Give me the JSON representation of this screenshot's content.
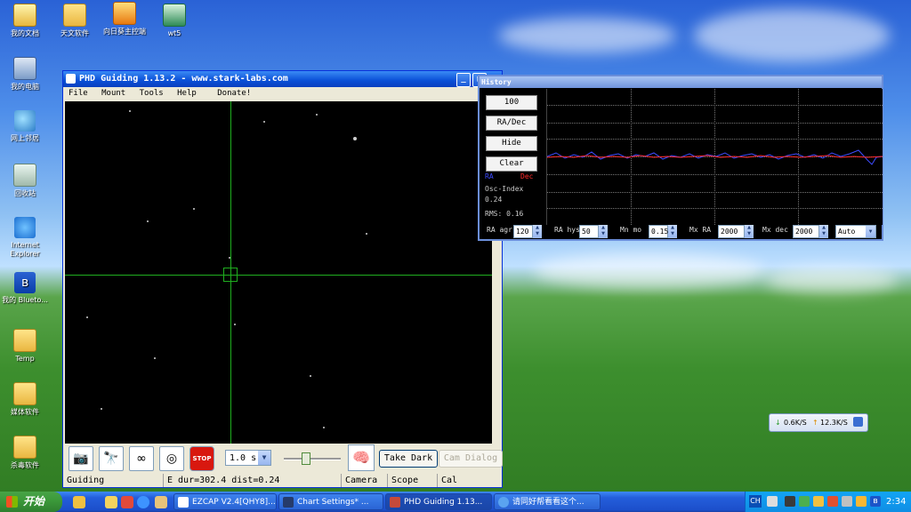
{
  "desktop": {
    "icons": [
      {
        "label": "我的文档"
      },
      {
        "label": "天文软件"
      },
      {
        "label": "向日葵主控端"
      },
      {
        "label": "wt5"
      },
      {
        "label": "我的电脑"
      },
      {
        "label": "网上邻居"
      },
      {
        "label": "回收站"
      },
      {
        "label": "Internet Explorer"
      },
      {
        "label": "我的 Blueto..."
      },
      {
        "label": "Temp"
      },
      {
        "label": "媒体软件"
      },
      {
        "label": "杀毒软件"
      }
    ]
  },
  "phd": {
    "title": "PHD Guiding 1.13.2  -  www.stark-labs.com",
    "menu": [
      "File",
      "Mount",
      "Tools",
      "Help",
      "Donate!"
    ],
    "exposure": "1.0 s",
    "take_dark": "Take Dark",
    "cam_dialog": "Cam Dialog",
    "status": {
      "mode": "Guiding",
      "info": "E dur=302.4 dist=0.24",
      "camera": "Camera",
      "scope": "Scope",
      "cal": "Cal"
    },
    "titlebar_buttons": {
      "minimize": "_",
      "maximize": "□"
    }
  },
  "history": {
    "title": "History",
    "buttons": {
      "length": "100",
      "mode": "RA/Dec",
      "hide": "Hide",
      "clear": "Clear"
    },
    "legend": {
      "ra": "RA",
      "dec": "Dec",
      "ra_color": "#3d4bff",
      "dec_color": "#ff2a2a"
    },
    "osc_label": "Osc-Index",
    "osc_value": "0.24",
    "rms": "RMS: 0.16",
    "controls": {
      "ra_agr_label": "RA agr",
      "ra_agr": "120",
      "ra_hys_label": "RA hys",
      "ra_hys": "50",
      "mn_mo_label": "Mn mo",
      "mn_mo": "0.15",
      "mx_ra_label": "Mx RA",
      "mx_ra": "2000",
      "mx_dec_label": "Mx dec",
      "mx_dec": "2000",
      "dec_mode": "Auto"
    }
  },
  "network": {
    "down": "0.6K/S",
    "up": "12.3K/S"
  },
  "taskbar": {
    "start": "开始",
    "tasks": [
      {
        "label": "EZCAP V2.4[QHY8]..."
      },
      {
        "label": "Chart Settings* ..."
      },
      {
        "label": "PHD Guiding 1.13..."
      },
      {
        "label": "请同好帮看看这个..."
      }
    ],
    "lang": "CH",
    "clock": "2:34"
  }
}
